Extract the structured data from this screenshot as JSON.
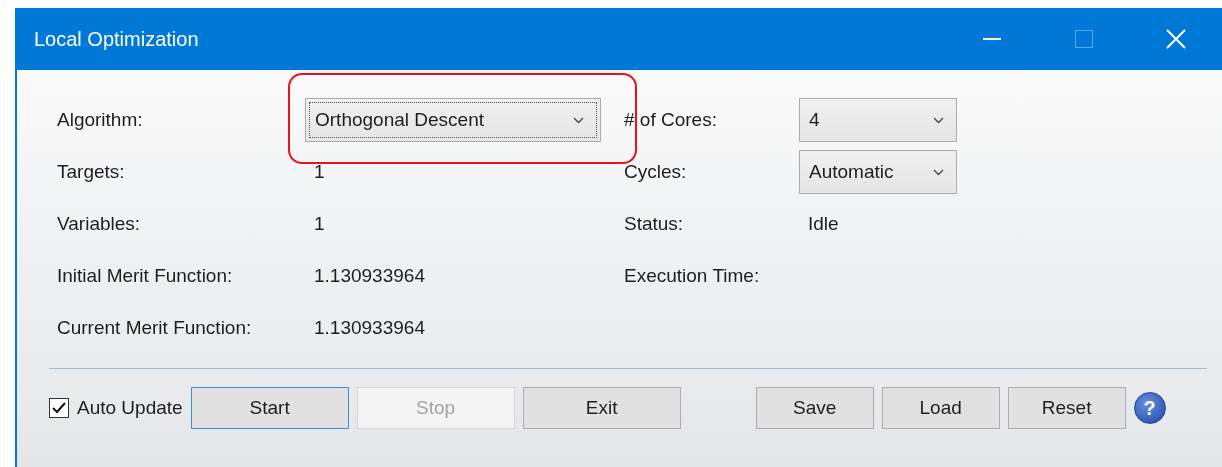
{
  "window": {
    "title": "Local Optimization"
  },
  "fields": [
    {
      "label": "Algorithm:",
      "kind": "dropdown",
      "value": "Orthogonal Descent",
      "focused": true,
      "highlighted": true
    },
    {
      "label": "Targets:",
      "kind": "text",
      "value": "1"
    },
    {
      "label": "Variables:",
      "kind": "text",
      "value": "1"
    },
    {
      "label": "Initial Merit Function:",
      "kind": "text",
      "value": "1.130933964"
    },
    {
      "label": "Current Merit Function:",
      "kind": "text",
      "value": "1.130933964"
    }
  ],
  "settings": [
    {
      "label": "# of Cores:",
      "kind": "dropdown",
      "value": "4"
    },
    {
      "label": "Cycles:",
      "kind": "dropdown",
      "value": "Automatic"
    },
    {
      "label": "Status:",
      "kind": "text",
      "value": "Idle"
    },
    {
      "label": "Execution Time:",
      "kind": "text"
    }
  ],
  "auto_update": {
    "label": "Auto Update",
    "checked": true
  },
  "run_buttons": [
    {
      "label": "Start",
      "disabled": false,
      "focused": true
    },
    {
      "label": "Stop",
      "disabled": true,
      "focused": false
    },
    {
      "label": "Exit",
      "disabled": false,
      "focused": false
    }
  ],
  "file_buttons": [
    {
      "label": "Save",
      "disabled": false,
      "focused": false
    },
    {
      "label": "Load",
      "disabled": false,
      "focused": false
    },
    {
      "label": "Reset",
      "disabled": false,
      "focused": false
    }
  ],
  "help": {
    "label": "?"
  }
}
